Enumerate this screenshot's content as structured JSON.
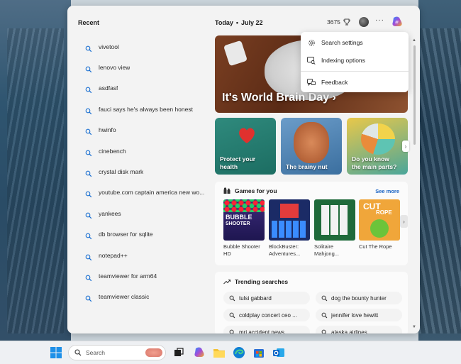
{
  "recent": {
    "title": "Recent",
    "items": [
      "vivetool",
      "lenovo view",
      "asdfasf",
      "fauci says he's always been honest",
      "hwinfo",
      "cinebench",
      "crystal disk mark",
      "youtube.com captain america new wo...",
      "yankees",
      "db browser for sqlite",
      "notepad++",
      "teamviewer for arm64",
      "teamviewer classic"
    ]
  },
  "header": {
    "today_label": "Today",
    "separator": "•",
    "date": "July 22",
    "points": "3675"
  },
  "hero": {
    "title": "It's World Brain Day",
    "arrow": "›"
  },
  "tiles": [
    {
      "caption_line1": "Protect your",
      "caption_line2": "health"
    },
    {
      "caption_line1": "The brainy nut",
      "caption_line2": ""
    },
    {
      "caption_line1": "Do you know",
      "caption_line2": "the main parts?"
    }
  ],
  "games": {
    "title": "Games for you",
    "see_more": "See more",
    "items": [
      {
        "name_line1": "Bubble Shooter",
        "name_line2": "HD",
        "art_text1": "BUBBLE",
        "art_text2": "SHOOTER"
      },
      {
        "name_line1": "BlockBuster:",
        "name_line2": "Adventures...",
        "art_text1": "",
        "art_text2": ""
      },
      {
        "name_line1": "Solitaire",
        "name_line2": "Mahjong...",
        "art_text1": "",
        "art_text2": ""
      },
      {
        "name_line1": "Cut The Rope",
        "name_line2": "",
        "art_text1": "CUT",
        "art_text2": "ROPE"
      }
    ]
  },
  "trending": {
    "title": "Trending searches",
    "items": [
      "tulsi gabbard",
      "dog the bounty hunter",
      "coldplay concert ceo ...",
      "jennifer love hewitt",
      "mri accident news",
      "alaska airlines"
    ]
  },
  "menu": {
    "items": [
      "Search settings",
      "Indexing options",
      "Feedback"
    ]
  },
  "taskbar": {
    "search_placeholder": "Search"
  },
  "colors": {
    "accent_link": "#1a63c4",
    "panel_bg": "#f3f3f3",
    "menu_bg": "#ffffff"
  },
  "icons": {
    "recent": "magnifier-icon",
    "menu": [
      "gear-icon",
      "indexing-icon",
      "feedback-icon"
    ],
    "taskbar": [
      "windows-start-icon",
      "taskview-icon",
      "copilot-icon",
      "file-explorer-icon",
      "edge-icon",
      "store-icon",
      "outlook-icon"
    ]
  }
}
